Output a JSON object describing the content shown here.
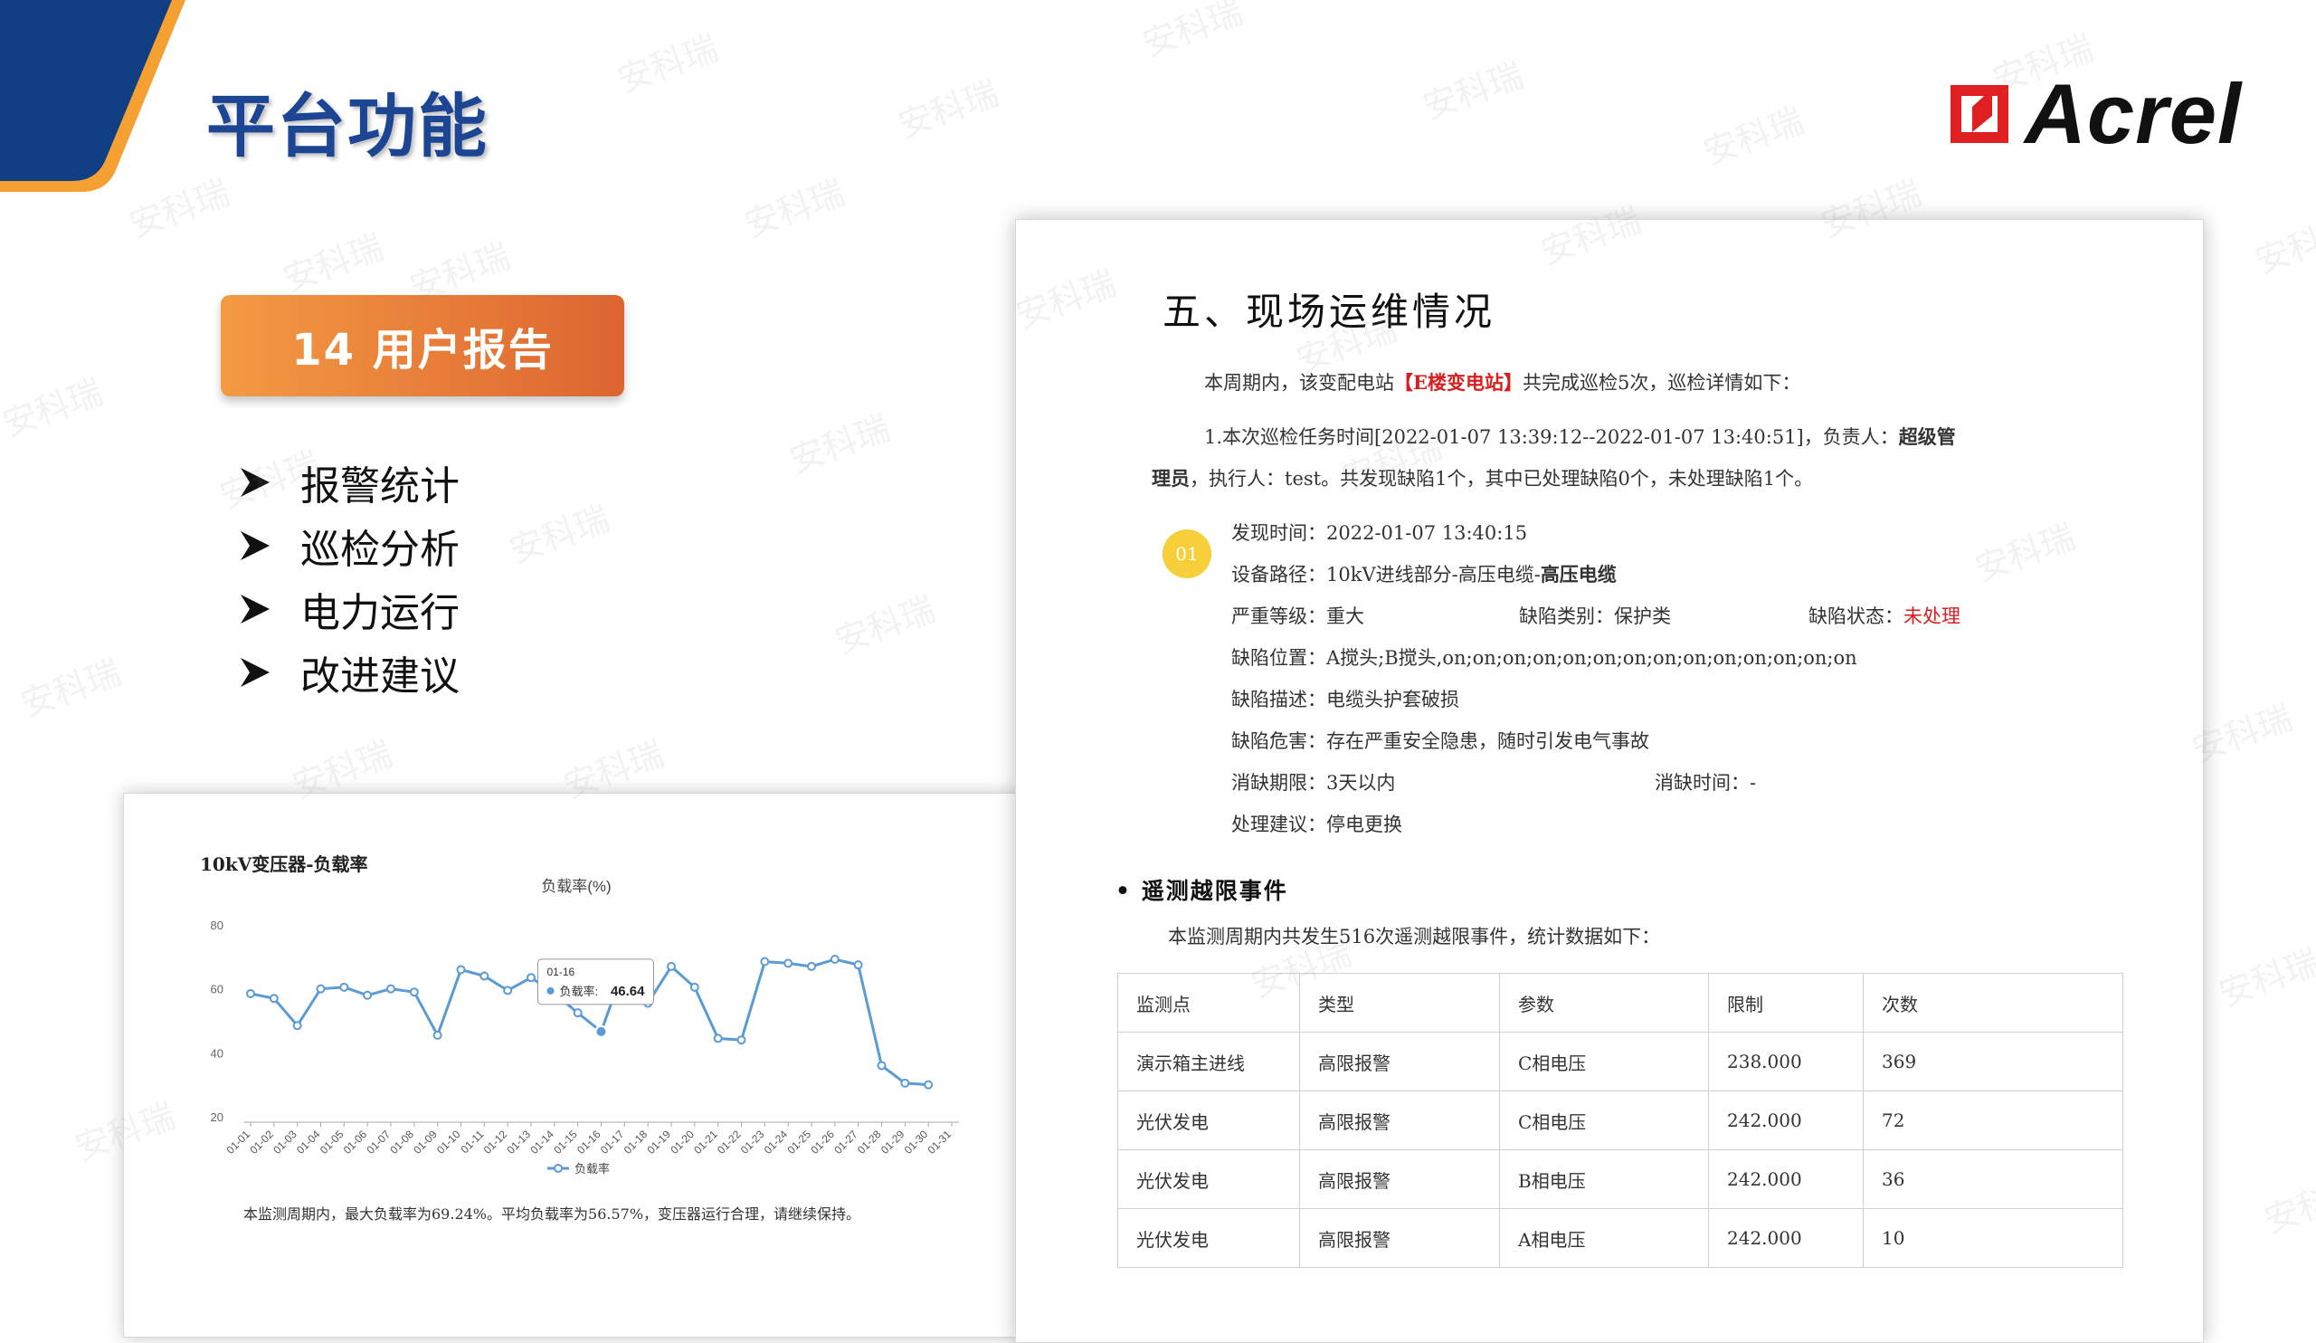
{
  "header": {
    "page_title": "平台功能",
    "brand_name": "Acrel",
    "colors": {
      "title_blue": "#1c4594",
      "corner_blue": "#103e82",
      "corner_orange": "#f5a033",
      "brand_red": "#e02020",
      "badge_orange": "#e97b36"
    }
  },
  "section": {
    "badge_label": "14 用户报告"
  },
  "features": [
    "报警统计",
    "巡检分析",
    "电力运行",
    "改进建议"
  ],
  "watermark_text": "安科瑞",
  "chart_card": {
    "title": "10kV变压器-负载率",
    "summary": "本监测周期内，最大负载率为69.24%。平均负载率为56.57%，变压器运行合理，请继续保持。",
    "tooltip": {
      "date": "01-16",
      "label": "负载率",
      "value": "46.64"
    }
  },
  "chart_data": {
    "type": "line",
    "title": "负载率(%)",
    "categories": [
      "01-01",
      "01-02",
      "01-03",
      "01-04",
      "01-05",
      "01-06",
      "01-07",
      "01-08",
      "01-09",
      "01-10",
      "01-11",
      "01-12",
      "01-13",
      "01-14",
      "01-15",
      "01-16",
      "01-17",
      "01-18",
      "01-19",
      "01-20",
      "01-21",
      "01-22",
      "01-23",
      "01-24",
      "01-25",
      "01-26",
      "01-27",
      "01-28",
      "01-29",
      "01-30",
      "01-31"
    ],
    "series": [
      {
        "name": "负载率",
        "values": [
          58.5,
          57,
          48.5,
          60,
          60.5,
          58,
          60,
          59,
          45.5,
          66,
          64,
          59.5,
          63.5,
          58.5,
          52.5,
          46.64,
          67,
          55.5,
          67,
          60.5,
          44.5,
          44,
          68.5,
          68,
          67,
          69.24,
          67.5,
          36,
          30.5,
          30
        ]
      }
    ],
    "y_ticks": [
      20,
      40,
      60,
      80
    ],
    "ylim": [
      20,
      80
    ],
    "grid": false,
    "legend_position": "bottom-center",
    "line_color": "#5b9bd5"
  },
  "report": {
    "heading": "五、现场运维情况",
    "intro": {
      "pre": "本周期内，该变配电站",
      "station": "【E楼变电站】",
      "post": "共完成巡检5次，巡检详情如下："
    },
    "task": {
      "line1_pre": "1.本次巡检任务时间[2022-01-07 13:39:12--2022-01-07 13:40:51]，负责人：",
      "owner_part1": "超级管",
      "owner_part2": "理员",
      "line2_post": "，执行人：test。共发现缺陷1个，其中已处理缺陷0个，未处理缺陷1个。"
    },
    "defect": {
      "index": "01",
      "found_time": "发现时间：2022-01-07 13:40:15",
      "device_path_pre": "设备路径：10kV进线部分-高压电缆-",
      "device_path_bold": "高压电缆",
      "severity": "严重等级：重大",
      "category": "缺陷类别：保护类",
      "status_label": "缺陷状态：",
      "status_value": "未处理",
      "location": "缺陷位置：A搅头;B搅头,on;on;on;on;on;on;on;on;on;on;on;on;on;on",
      "description": "缺陷描述：电缆头护套破损",
      "hazard": "缺陷危害：存在严重安全隐患，随时引发电气事故",
      "deadline": "消缺期限：3天以内",
      "fix_time": "消缺时间：-",
      "suggestion": "处理建议：停电更换"
    },
    "telemetry": {
      "title": "遥测越限事件",
      "summary": "本监测周期内共发生516次遥测越限事件，统计数据如下：",
      "headers": [
        "监测点",
        "类型",
        "参数",
        "限制",
        "次数"
      ],
      "rows": [
        [
          "演示箱主进线",
          "高限报警",
          "C相电压",
          "238.000",
          "369"
        ],
        [
          "光伏发电",
          "高限报警",
          "C相电压",
          "242.000",
          "72"
        ],
        [
          "光伏发电",
          "高限报警",
          "B相电压",
          "242.000",
          "36"
        ],
        [
          "光伏发电",
          "高限报警",
          "A相电压",
          "242.000",
          "10"
        ]
      ]
    }
  }
}
